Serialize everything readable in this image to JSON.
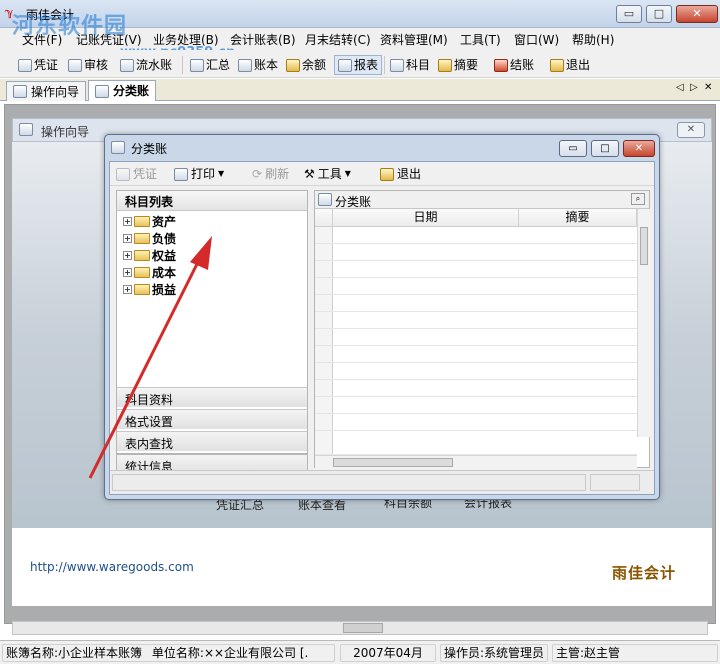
{
  "window": {
    "title": "雨佳会计",
    "watermark": "河东软件园",
    "watermark_url": "www.pc0359.cn",
    "min_label": "▭",
    "max_label": "□",
    "close_label": "✕"
  },
  "menu": [
    "文件(F)",
    "记账凭证(V)",
    "业务处理(B)",
    "会计账表(B)",
    "月末结转(C)",
    "资料管理(M)",
    "工具(T)",
    "窗口(W)",
    "帮助(H)"
  ],
  "toolbar": [
    "凭证",
    "审核",
    "流水账",
    "汇总",
    "账本",
    "余额",
    "报表",
    "科目",
    "摘要",
    "结账",
    "退出"
  ],
  "tabs": [
    "操作向导",
    "分类账"
  ],
  "tab_nav": {
    "left": "◁",
    "right": "▷",
    "close": "✕"
  },
  "guide": {
    "title": "操作向导",
    "labels": [
      "凭证汇总",
      "账本查看",
      "科目余额",
      "会计报表"
    ],
    "url": "http://www.waregoods.com",
    "brand": "雨佳会计"
  },
  "dialog": {
    "title": "分类账",
    "toolbar": [
      {
        "label": "凭证",
        "disabled": true
      },
      {
        "label": "打印",
        "disabled": false
      },
      {
        "label": "刷新",
        "disabled": true
      },
      {
        "label": "工具",
        "disabled": false
      },
      {
        "label": "退出",
        "disabled": false
      }
    ],
    "left_panel": {
      "header": "科目列表",
      "tree": [
        "资产",
        "负债",
        "权益",
        "成本",
        "损益"
      ],
      "sections": [
        "科目列表",
        "科目资料",
        "格式设置",
        "表内查找",
        "统计信息"
      ]
    },
    "right_panel": {
      "header": "分类账",
      "columns": [
        "日期",
        "摘要"
      ]
    }
  },
  "status": {
    "book_label": "账簿名称:",
    "book": "小企业样本账簿",
    "company_label": "单位名称:",
    "company": "××企业有限公司 [.",
    "period": "2007年04月",
    "operator_label": "操作员:",
    "operator": "系统管理员",
    "supervisor_label": "主管:",
    "supervisor": "赵主管"
  },
  "colors": {
    "accent": "#2f6db5",
    "brand": "#8a5400",
    "arrow": "#d42a2a"
  }
}
